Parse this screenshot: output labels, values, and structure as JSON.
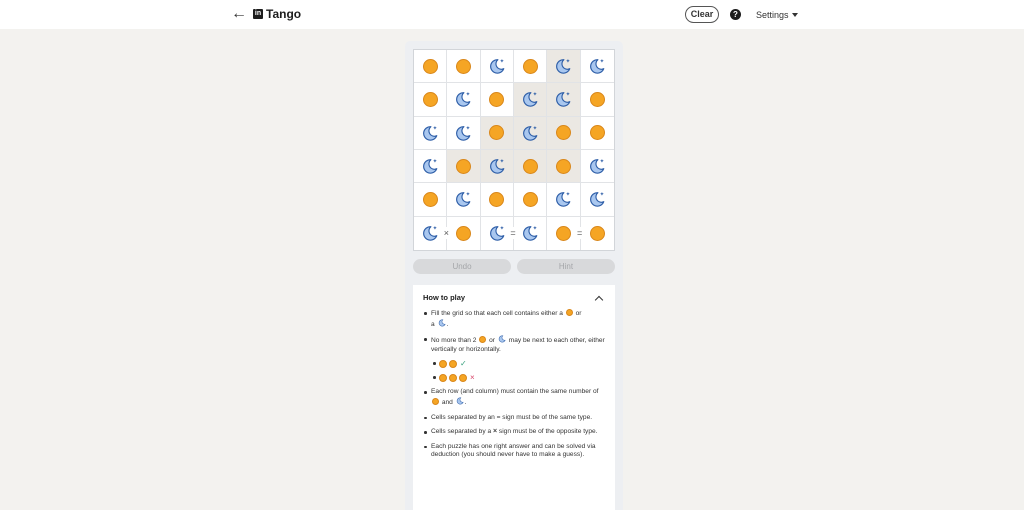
{
  "header": {
    "back_icon": "arrow-left-icon",
    "logo_text": "in",
    "title": "Tango",
    "clear_label": "Clear",
    "help_label": "?",
    "settings_label": "Settings"
  },
  "board": {
    "rows": [
      [
        "sun",
        "sun",
        "moon",
        "sun",
        "moon",
        "moon"
      ],
      [
        "sun",
        "moon",
        "sun",
        "moon",
        "moon",
        "sun"
      ],
      [
        "moon",
        "moon",
        "sun",
        "moon",
        "sun",
        "sun"
      ],
      [
        "moon",
        "sun",
        "moon",
        "sun",
        "sun",
        "moon"
      ],
      [
        "sun",
        "moon",
        "sun",
        "sun",
        "moon",
        "moon"
      ],
      [
        "moon",
        "sun",
        "moon",
        "moon",
        "sun",
        "sun"
      ]
    ],
    "shaded": [
      [
        0,
        4
      ],
      [
        1,
        3
      ],
      [
        1,
        4
      ],
      [
        2,
        2
      ],
      [
        2,
        3
      ],
      [
        2,
        4
      ],
      [
        3,
        1
      ],
      [
        3,
        2
      ],
      [
        3,
        3
      ],
      [
        3,
        4
      ]
    ],
    "signs": [
      {
        "row": 5,
        "after_col": 0,
        "symbol": "×"
      },
      {
        "row": 5,
        "after_col": 2,
        "symbol": "="
      },
      {
        "row": 5,
        "after_col": 4,
        "symbol": "="
      }
    ]
  },
  "controls": {
    "undo_label": "Undo",
    "hint_label": "Hint"
  },
  "how_to_play": {
    "title": "How to play",
    "rule1": {
      "a": "Fill the grid so that each cell contains either a",
      "b": "or",
      "c": "a",
      "d": "."
    },
    "rule2": {
      "a": "No more than 2",
      "b": "or",
      "c": "may be next to each other, either vertically or horizontally."
    },
    "example_ok": "✓",
    "example_bad": "×",
    "rule3": {
      "a": "Each row (and column) must contain the same number of",
      "b": "and",
      "c": "."
    },
    "rule4": "Cells separated by an = sign must be of the same type.",
    "rule5": {
      "a": "Cells separated by a",
      "sym": "×",
      "b": "sign must be of the opposite type."
    },
    "rule6": "Each puzzle has one right answer and can be solved via deduction (you should never have to make a guess)."
  },
  "colors": {
    "sun": "#f5a524",
    "moon": "#a9c7ef",
    "shade": "#ebe8e3",
    "background": "#f3f2ef"
  }
}
